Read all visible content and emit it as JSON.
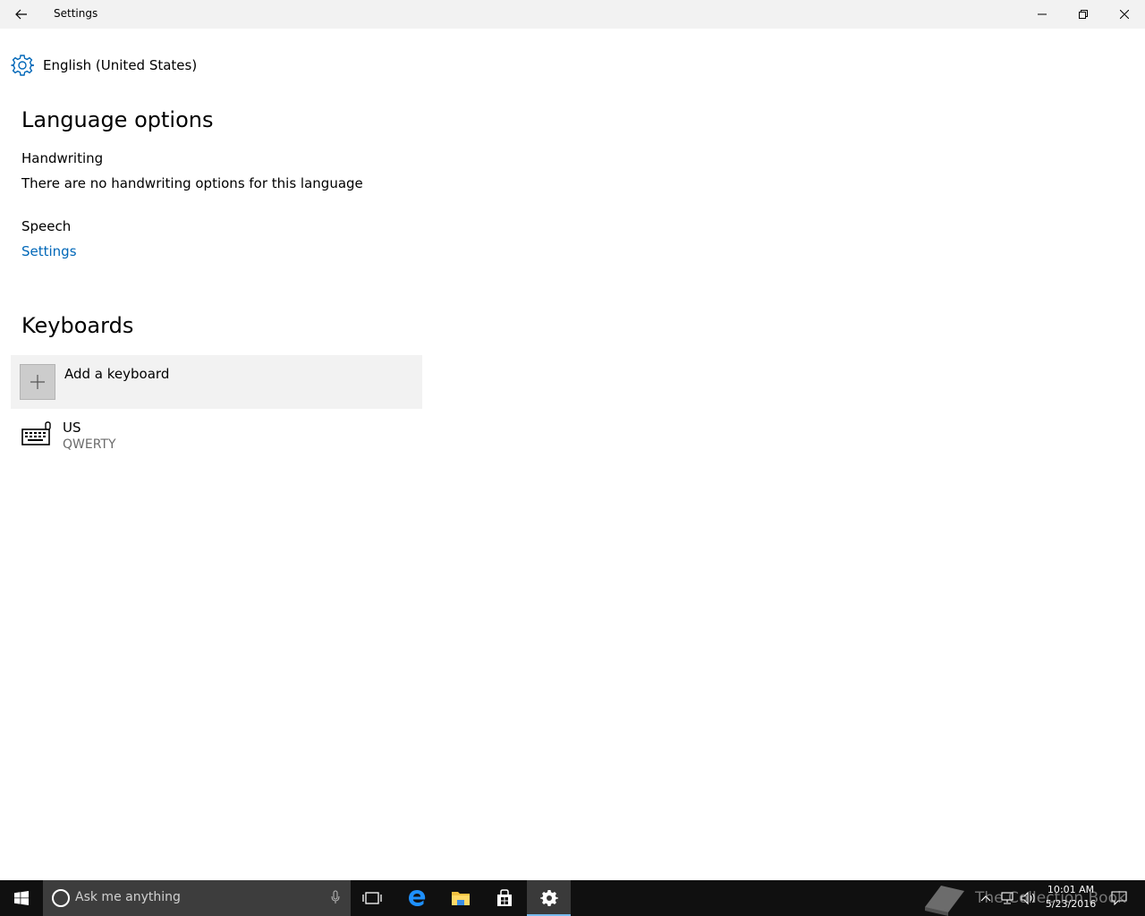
{
  "window": {
    "title": "Settings"
  },
  "header": {
    "language": "English (United States)"
  },
  "language_options": {
    "heading": "Language options",
    "handwriting_label": "Handwriting",
    "handwriting_text": "There are no handwriting options for this language",
    "speech_label": "Speech",
    "speech_link": "Settings"
  },
  "keyboards": {
    "heading": "Keyboards",
    "add_label": "Add a keyboard",
    "items": [
      {
        "name": "US",
        "layout": "QWERTY"
      }
    ]
  },
  "taskbar": {
    "search_placeholder": "Ask me anything",
    "watermark": "The Collection Book",
    "time": "10:01 AM",
    "date": "5/23/2016"
  },
  "colors": {
    "accent": "#0067b8",
    "taskbar": "#101010",
    "active_indicator": "#76b9ed"
  }
}
